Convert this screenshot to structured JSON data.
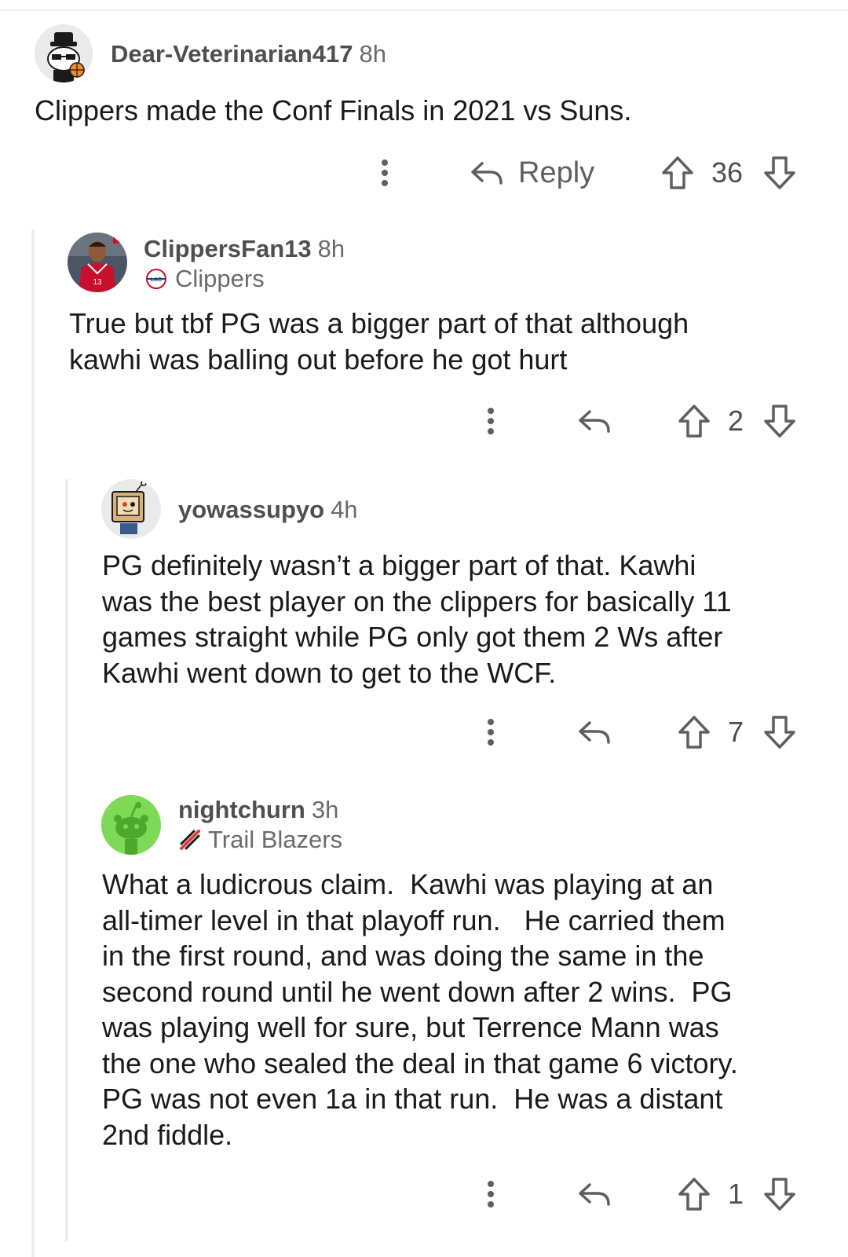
{
  "comments": [
    {
      "username": "Dear-Veterinarian417",
      "time": "8h",
      "flair": "",
      "body": "Clippers made the Conf Finals in 2021 vs Suns.",
      "reply_label": "Reply",
      "score": "36",
      "avatar": "snoo-avatar-sunglasses-hat"
    },
    {
      "username": "ClippersFan13",
      "time": "8h",
      "flair": "Clippers",
      "flair_icon": "clippers-logo-icon",
      "body": "True but tbf PG was a bigger part of that although\nkawhi was balling out before he got hurt",
      "score": "2",
      "avatar": "basketball-player-avatar"
    },
    {
      "username": "yowassupyo",
      "time": "4h",
      "flair": "",
      "body": "PG definitely wasn’t a bigger part of that. Kawhi\nwas the best player on the clippers for basically 11\ngames straight while PG only got them 2 Ws after\nKawhi went down to get to the WCF.",
      "score": "7",
      "avatar": "snoo-avatar-tv-head"
    },
    {
      "username": "nightchurn",
      "time": "3h",
      "flair": "Trail Blazers",
      "flair_icon": "trail-blazers-logo-icon",
      "body": "What a ludicrous claim.  Kawhi was playing at an\nall-timer level in that playoff run.   He carried them\nin the first round, and was doing the same in the\nsecond round until he went down after 2 wins.  PG\nwas playing well for sure, but Terrence Mann was\nthe one who sealed the deal in that game 6 victory.\nPG was not even 1a in that run.  He was a distant\n2nd fiddle.",
      "score": "1",
      "avatar": "snoo-avatar-green"
    }
  ],
  "colors": {
    "text": "#1a1a1b",
    "meta": "#6b6b6b",
    "icon": "#5f5f5f",
    "thread_line": "#ededed",
    "snoo_green": "#7ed957",
    "clippers_red": "#c8102e",
    "clippers_blue": "#1d428a",
    "blazers_red": "#e03a3e"
  }
}
